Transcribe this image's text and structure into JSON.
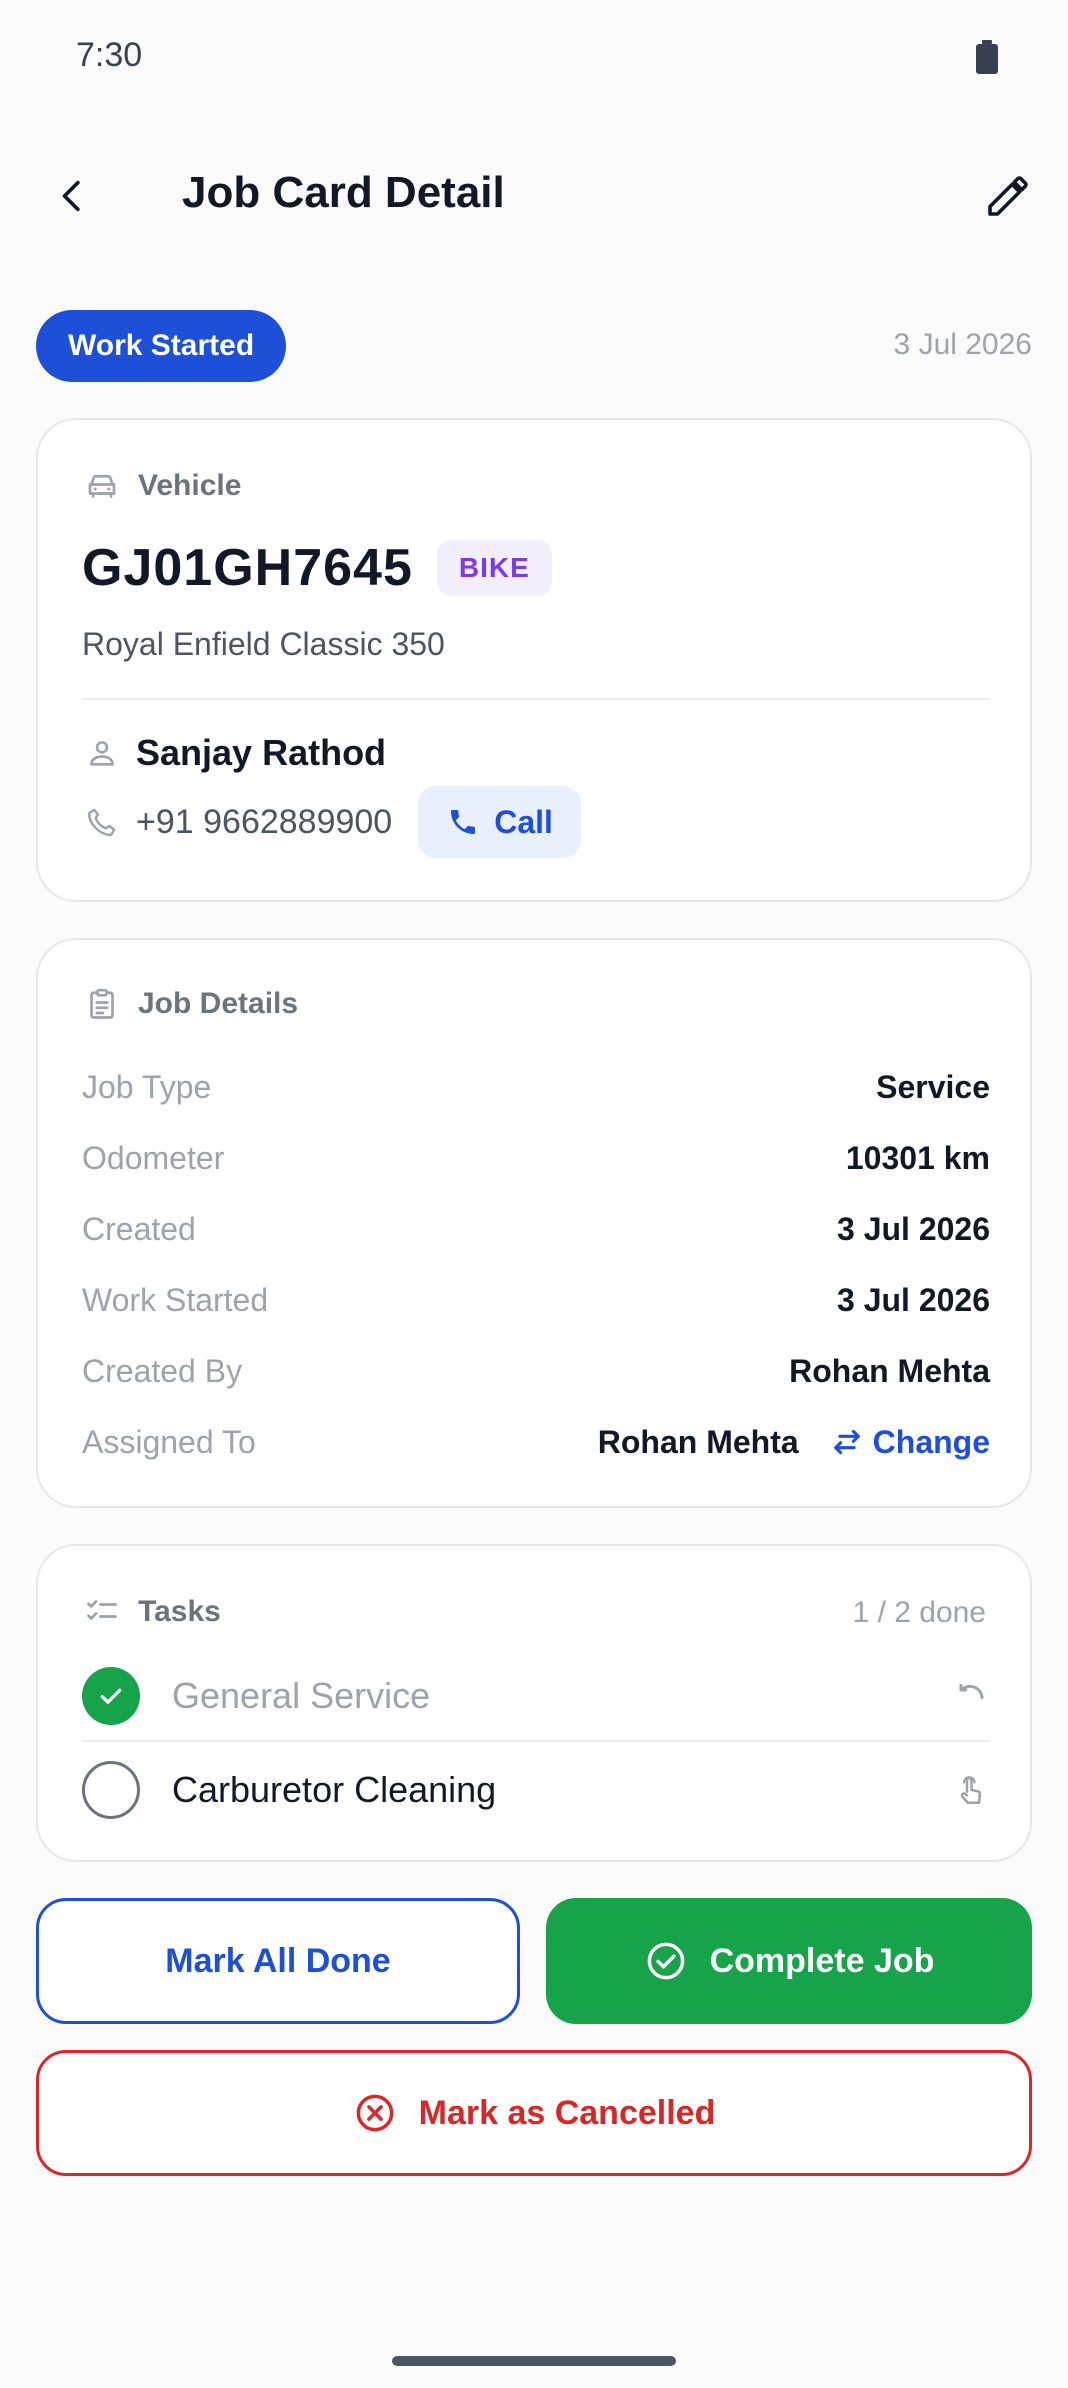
{
  "status_bar": {
    "time": "7:30"
  },
  "app_bar": {
    "title": "Job Card Detail"
  },
  "job": {
    "status": "Work Started",
    "date": "3 Jul 2026"
  },
  "vehicle": {
    "section_label": "Vehicle",
    "plate": "GJ01GH7645",
    "type": "BIKE",
    "model": "Royal Enfield Classic 350",
    "owner_name": "Sanjay Rathod",
    "phone": "+91 9662889900",
    "call_label": "Call"
  },
  "job_details": {
    "section_label": "Job Details",
    "rows": [
      {
        "label": "Job Type",
        "value": "Service"
      },
      {
        "label": "Odometer",
        "value": "10301 km"
      },
      {
        "label": "Created",
        "value": "3 Jul 2026"
      },
      {
        "label": "Work Started",
        "value": "3 Jul 2026"
      },
      {
        "label": "Created By",
        "value": "Rohan Mehta"
      },
      {
        "label": "Assigned To",
        "value": "Rohan Mehta"
      }
    ],
    "change_label": "Change"
  },
  "tasks": {
    "section_label": "Tasks",
    "progress": "1 / 2 done",
    "items": [
      {
        "name": "General Service",
        "done": true,
        "action_icon": "undo-icon"
      },
      {
        "name": "Carburetor Cleaning",
        "done": false,
        "action_icon": "tap-icon"
      }
    ]
  },
  "actions": {
    "mark_all_done": "Mark All Done",
    "complete_job": "Complete Job",
    "mark_cancelled": "Mark as Cancelled"
  },
  "colors": {
    "primary": "#1d4fd8",
    "success": "#16a34a",
    "danger": "#dc2626",
    "bike_badge": "#7c3aed"
  }
}
